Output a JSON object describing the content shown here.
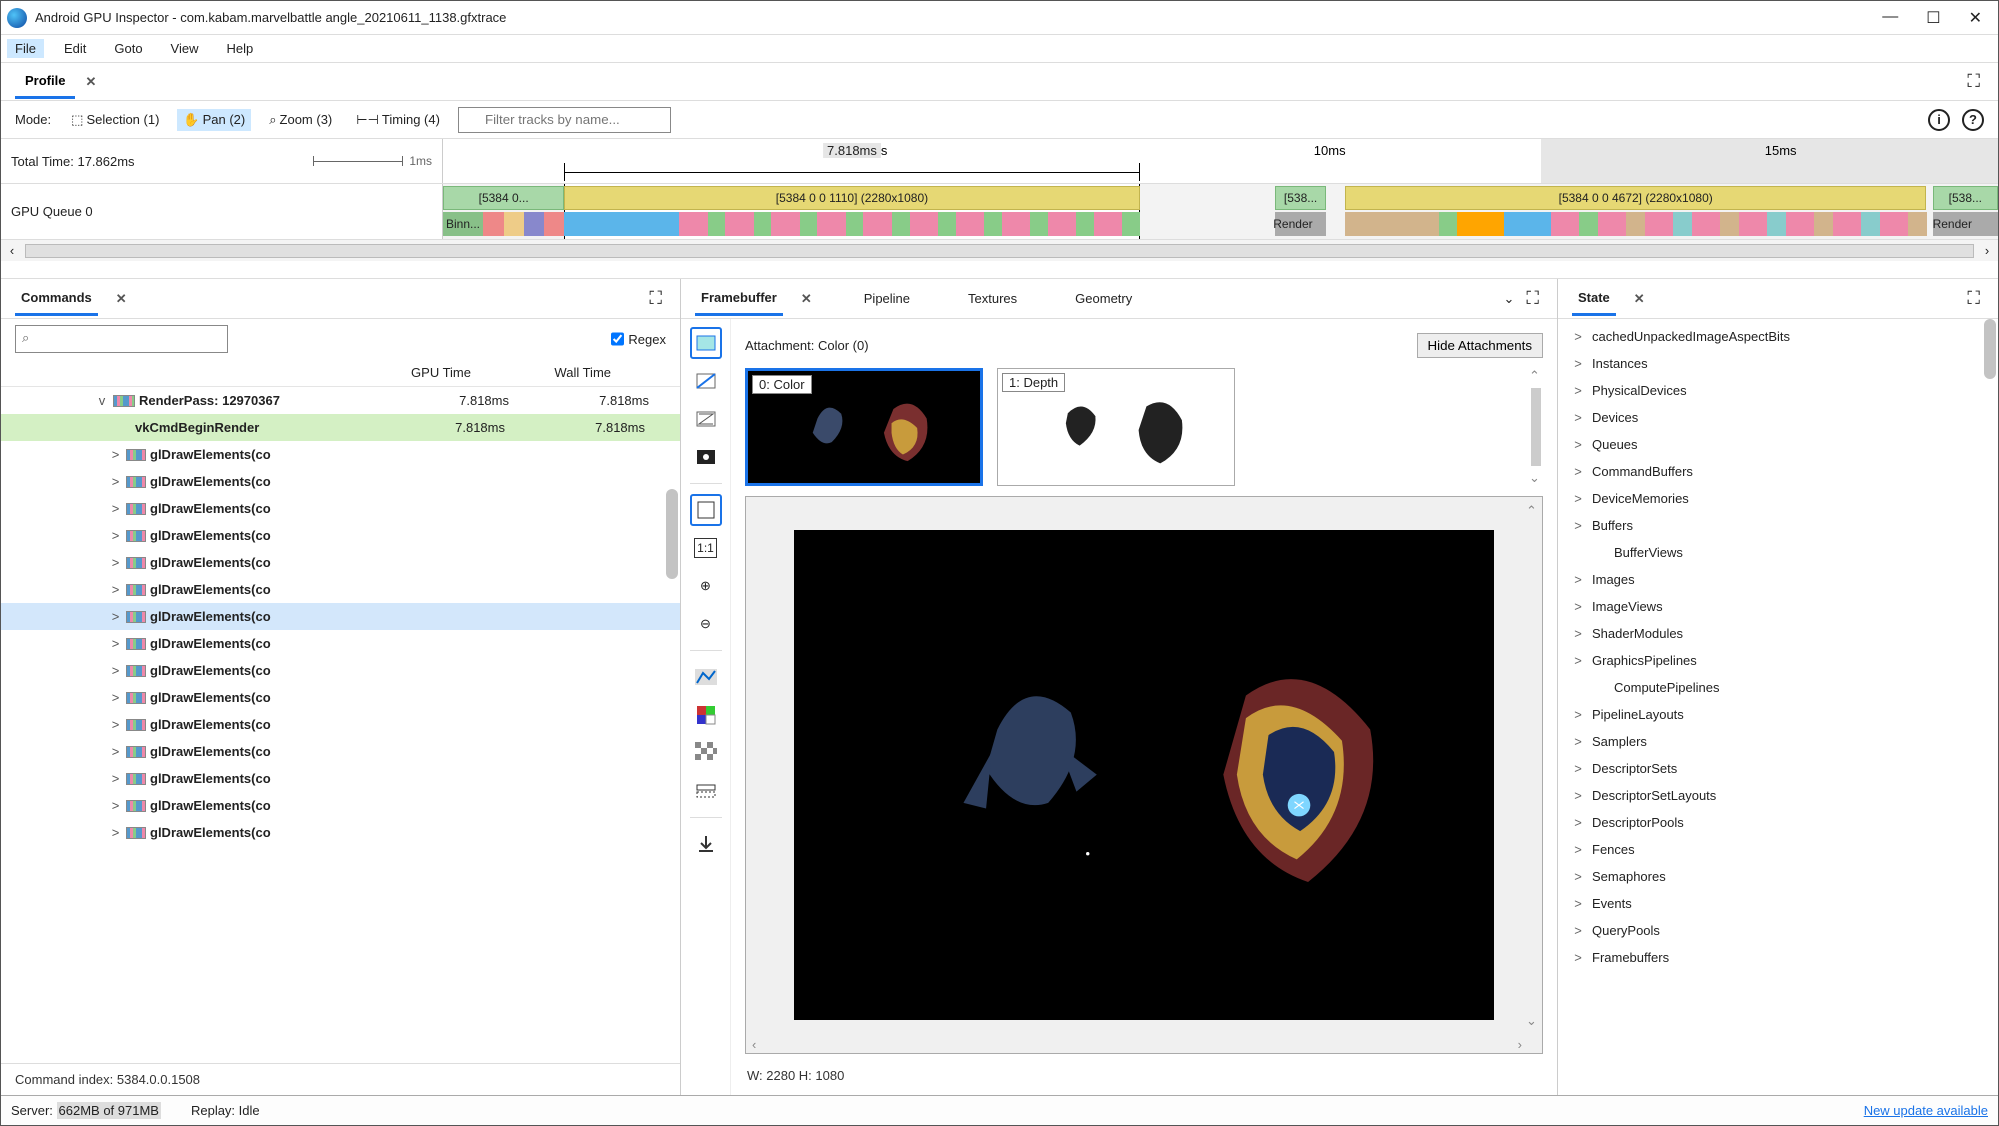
{
  "window": {
    "title": "Android GPU Inspector - com.kabam.marvelbattle angle_20210611_1138.gfxtrace"
  },
  "menu": {
    "file": "File",
    "edit": "Edit",
    "goto": "Goto",
    "view": "View",
    "help": "Help"
  },
  "profile_tab": {
    "label": "Profile"
  },
  "mode_bar": {
    "mode_label": "Mode:",
    "selection": "Selection (1)",
    "pan": "Pan (2)",
    "zoom": "Zoom (3)",
    "timing": "Timing (4)",
    "filter_placeholder": "Filter tracks by name..."
  },
  "timeline": {
    "total_time": "Total Time: 17.862ms",
    "scale_unit": "1ms",
    "ticks": {
      "t5": "5ms",
      "t10": "10ms",
      "t15": "15ms"
    },
    "range_label": "7.818ms",
    "queue_label": "GPU Queue 0",
    "bars": {
      "b0": "[5384 0...",
      "b0_sub": "Binn...",
      "b1": "[5384 0 0 1110] (2280x1080)",
      "b2": "[538...",
      "b2_sub": "Render",
      "b3": "[5384 0 0 4672] (2280x1080)",
      "b4": "[538...",
      "b4_sub": "Render"
    }
  },
  "commands": {
    "tab": "Commands",
    "regex": "Regex",
    "headers": {
      "gpu": "GPU Time",
      "wall": "Wall Time"
    },
    "rows": [
      {
        "indent": 70,
        "chev": "v",
        "name": "RenderPass: 12970367",
        "gpu": "7.818ms",
        "wall": "7.818ms",
        "hl": ""
      },
      {
        "indent": 92,
        "chev": "",
        "name": "vkCmdBeginRender",
        "gpu": "7.818ms",
        "wall": "7.818ms",
        "hl": "green",
        "bar": false
      },
      {
        "indent": 92,
        "chev": ">",
        "name": "glDrawElements(co",
        "gpu": "",
        "wall": "",
        "hl": ""
      },
      {
        "indent": 92,
        "chev": ">",
        "name": "glDrawElements(co",
        "gpu": "",
        "wall": "",
        "hl": ""
      },
      {
        "indent": 92,
        "chev": ">",
        "name": "glDrawElements(co",
        "gpu": "",
        "wall": "",
        "hl": ""
      },
      {
        "indent": 92,
        "chev": ">",
        "name": "glDrawElements(co",
        "gpu": "",
        "wall": "",
        "hl": ""
      },
      {
        "indent": 92,
        "chev": ">",
        "name": "glDrawElements(co",
        "gpu": "",
        "wall": "",
        "hl": ""
      },
      {
        "indent": 92,
        "chev": ">",
        "name": "glDrawElements(co",
        "gpu": "",
        "wall": "",
        "hl": ""
      },
      {
        "indent": 92,
        "chev": ">",
        "name": "glDrawElements(co",
        "gpu": "",
        "wall": "",
        "hl": "blue"
      },
      {
        "indent": 92,
        "chev": ">",
        "name": "glDrawElements(co",
        "gpu": "",
        "wall": "",
        "hl": ""
      },
      {
        "indent": 92,
        "chev": ">",
        "name": "glDrawElements(co",
        "gpu": "",
        "wall": "",
        "hl": ""
      },
      {
        "indent": 92,
        "chev": ">",
        "name": "glDrawElements(co",
        "gpu": "",
        "wall": "",
        "hl": ""
      },
      {
        "indent": 92,
        "chev": ">",
        "name": "glDrawElements(co",
        "gpu": "",
        "wall": "",
        "hl": ""
      },
      {
        "indent": 92,
        "chev": ">",
        "name": "glDrawElements(co",
        "gpu": "",
        "wall": "",
        "hl": ""
      },
      {
        "indent": 92,
        "chev": ">",
        "name": "glDrawElements(co",
        "gpu": "",
        "wall": "",
        "hl": ""
      },
      {
        "indent": 92,
        "chev": ">",
        "name": "glDrawElements(co",
        "gpu": "",
        "wall": "",
        "hl": ""
      },
      {
        "indent": 92,
        "chev": ">",
        "name": "glDrawElements(co",
        "gpu": "",
        "wall": "",
        "hl": ""
      }
    ],
    "footer": "Command index: 5384.0.0.1508"
  },
  "framebuffer": {
    "tabs": {
      "framebuffer": "Framebuffer",
      "pipeline": "Pipeline",
      "textures": "Textures",
      "geometry": "Geometry"
    },
    "attachment": "Attachment: Color (0)",
    "hide_attachments": "Hide Attachments",
    "thumbs": {
      "color": "0: Color",
      "depth": "1: Depth"
    },
    "dims": "W: 2280 H: 1080"
  },
  "state": {
    "tab": "State",
    "items": [
      "cachedUnpackedImageAspectBits",
      "Instances",
      "PhysicalDevices",
      "Devices",
      "Queues",
      "CommandBuffers",
      "DeviceMemories",
      "Buffers",
      "BufferViews",
      "Images",
      "ImageViews",
      "ShaderModules",
      "GraphicsPipelines",
      "ComputePipelines",
      "PipelineLayouts",
      "Samplers",
      "DescriptorSets",
      "DescriptorSetLayouts",
      "DescriptorPools",
      "Fences",
      "Semaphores",
      "Events",
      "QueryPools",
      "Framebuffers"
    ],
    "no_chev": [
      "BufferViews",
      "ComputePipelines"
    ]
  },
  "status": {
    "server_prefix": "Server: ",
    "server_mem": "662MB of 971MB",
    "replay": "Replay: Idle",
    "update": "New update available"
  }
}
